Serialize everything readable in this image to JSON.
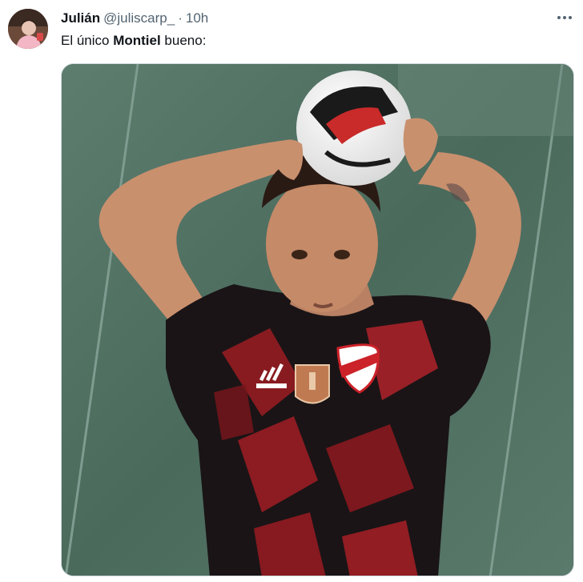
{
  "tweet": {
    "author": {
      "display_name": "Julián",
      "handle": "@juliscarp_",
      "separator": "·",
      "time": "10h"
    },
    "text": {
      "part1": "El único ",
      "bold": "Montiel",
      "part2": " bueno:"
    },
    "image": {
      "subject": "footballer in black and red jersey holding ball above head for throw-in",
      "jersey_brand": "adidas",
      "crest": "CARP"
    },
    "icons": {
      "more": "more-dots-icon"
    },
    "colors": {
      "text": "#0f1419",
      "secondary": "#536471",
      "border": "#cfd9de"
    }
  }
}
